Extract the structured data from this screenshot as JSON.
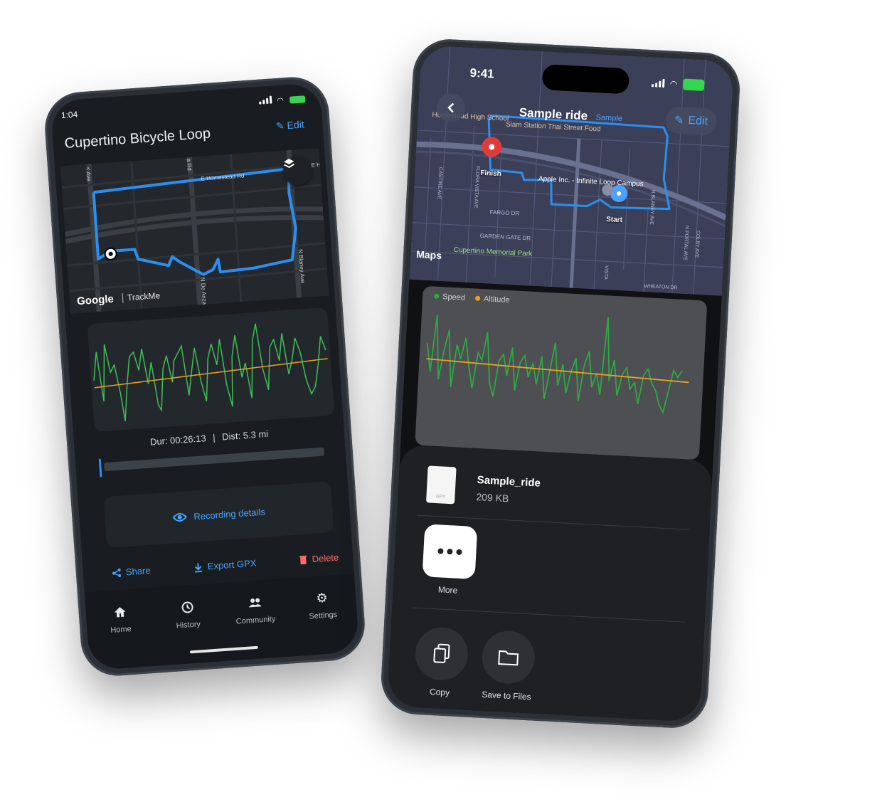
{
  "left_phone": {
    "status": {
      "time": "1:04"
    },
    "title": "Cupertino Bicycle Loop",
    "edit_label": "Edit",
    "map": {
      "streets": [
        "E Homestead Rd",
        "N De Anza Blvd",
        "N Blaney Ave",
        "a Rd",
        "< Ave",
        "E H"
      ],
      "attribution_google": "Google",
      "attribution_app": "TrackMe"
    },
    "stats": {
      "duration": "Dur: 00:26:13",
      "separator": "|",
      "distance": "Dist: 5.3 mi"
    },
    "recording_details_label": "Recording details",
    "actions": {
      "share": "Share",
      "export": "Export GPX",
      "delete": "Delete"
    },
    "tabs": [
      {
        "label": "Home",
        "icon": "home-icon"
      },
      {
        "label": "History",
        "icon": "history-icon"
      },
      {
        "label": "Community",
        "icon": "community-icon"
      },
      {
        "label": "Settings",
        "icon": "gear-icon"
      }
    ],
    "colors": {
      "accent": "#4aa3ff",
      "delete": "#ff6b6b",
      "speed": "#3fbf55",
      "altitude": "#f0a020"
    }
  },
  "right_phone": {
    "status": {
      "time": "9:41"
    },
    "title": "Sample ride",
    "badge": "Sample",
    "edit_label": "Edit",
    "map": {
      "labels": [
        "Homestead High School",
        "Siam Station Thai Street Food",
        "Apple Inc. - Infinite Loop Campus",
        "FARGO DR",
        "GARDEN GATE DR",
        "Cupertino Memorial Park",
        "N BLANEY AVE",
        "FLORA VISTA AVE",
        "CASTINE AVE",
        "N PORTAL AVE",
        "COLBY AVE",
        "WHEATON DR",
        "VISTA"
      ],
      "finish_label": "Finish",
      "start_label": "Start",
      "maps_logo": "Maps"
    },
    "chart_legend": {
      "speed": "Speed",
      "altitude": "Altitude"
    },
    "share_sheet": {
      "file_name": "Sample_ride",
      "file_size": "209 KB",
      "file_ext": "GPX",
      "more_label": "More",
      "copy_label": "Copy",
      "save_label": "Save to Files"
    },
    "colors": {
      "accent": "#4aa3ff",
      "speed": "#2fa844",
      "altitude": "#f0a020",
      "finish_pin": "#e03b3b",
      "start_pin": "#4aa3ff"
    }
  }
}
